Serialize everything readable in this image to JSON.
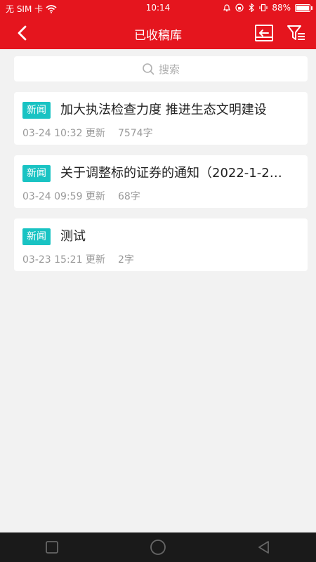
{
  "status": {
    "carrier": "无 SIM 卡",
    "time": "10:14",
    "battery": "88%",
    "battery_level": 0.88,
    "icons": [
      "wifi-icon",
      "alarm-icon",
      "lock-rotation-icon",
      "bluetooth-icon",
      "vibrate-icon",
      "battery-icon"
    ]
  },
  "header": {
    "title": "已收稿库",
    "back_icon": "back-arrow-icon",
    "action1_icon": "import-icon",
    "action2_icon": "filter-icon"
  },
  "search": {
    "placeholder": "搜索"
  },
  "items": [
    {
      "tag": "新闻",
      "title": "加大执法检查力度 推进生态文明建设",
      "time": "03-24 10:32 更新",
      "words": "7574字"
    },
    {
      "tag": "新闻",
      "title": "关于调整标的证券的通知（2022-1-2…",
      "time": "03-24 09:59 更新",
      "words": "68字"
    },
    {
      "tag": "新闻",
      "title": "测试",
      "time": "03-23 15:21 更新",
      "words": "2字"
    }
  ],
  "colors": {
    "primary": "#e5151e",
    "tag": "#19c3c3",
    "background": "#f2f2f2"
  },
  "nav": {
    "icons": [
      "recent-apps-icon",
      "home-icon",
      "back-triangle-icon"
    ]
  }
}
